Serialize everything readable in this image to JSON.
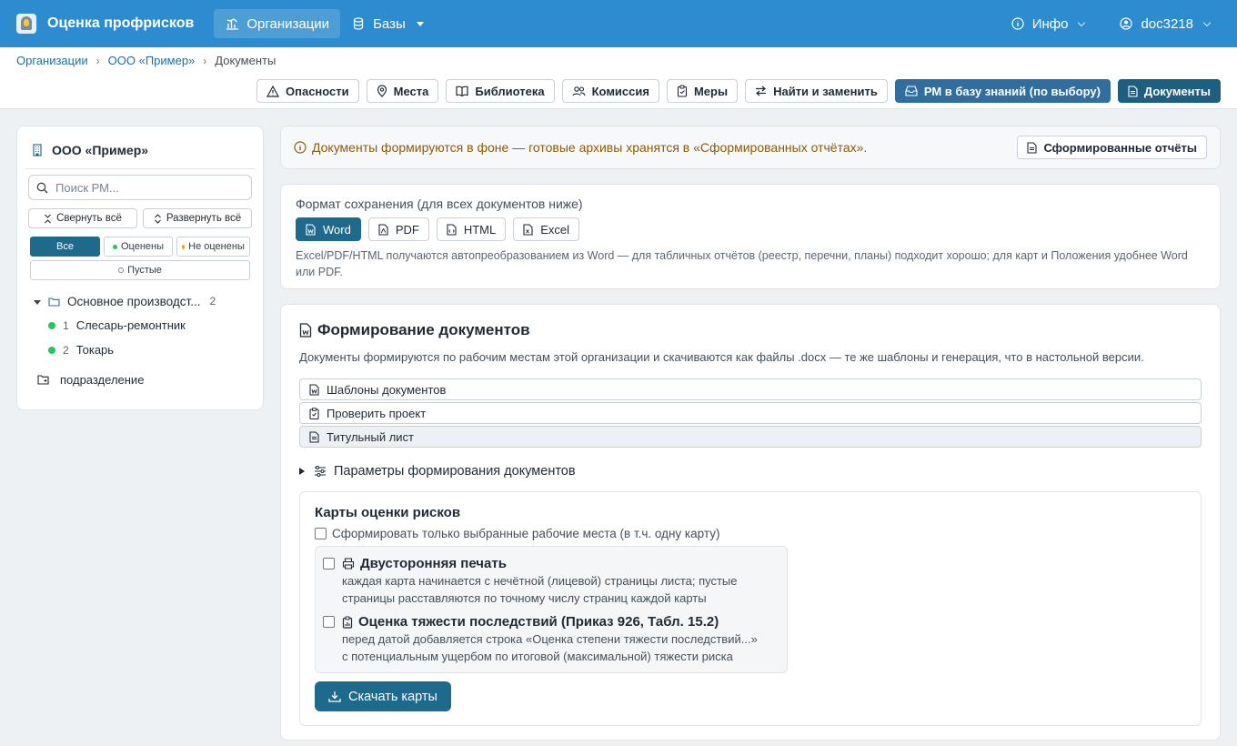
{
  "navbar": {
    "brand": "Оценка профрисков",
    "links": [
      {
        "label": "Организации",
        "icon": "bar-chart-icon",
        "active": true
      },
      {
        "label": "Базы",
        "icon": "database-icon",
        "active": false
      }
    ],
    "info": "Инфо",
    "user": "doc3218",
    "bg_color": "#2d8ccf"
  },
  "breadcrumb": {
    "items": [
      "Организации",
      "ООО «Пример»"
    ],
    "current": "Документы"
  },
  "toolbar": {
    "buttons": [
      "Опасности",
      "Места",
      "Библиотека",
      "Комиссия",
      "Меры",
      "Найти и заменить",
      "РМ в базу знаний (по выбору)",
      "Документы"
    ]
  },
  "sidebar": {
    "org_name": "ООО «Пример»",
    "search_placeholder": "Поиск РМ...",
    "collapse_label": "Свернуть всё",
    "expand_label": "Развернуть всё",
    "filters": [
      "Все",
      "Оценены",
      "Не оценены",
      "Пустые"
    ],
    "tree": {
      "group_label": "Основное производст...",
      "group_count": "2",
      "items": [
        {
          "num": "1",
          "label": "Слесарь-ремонтник"
        },
        {
          "num": "2",
          "label": "Токарь"
        }
      ],
      "dept_label": "подразделение"
    }
  },
  "notice": {
    "text": "Документы формируются в фоне — готовые архивы хранятся в «Сформированных отчётах».",
    "button": "Сформированные отчёты"
  },
  "format": {
    "label": "Формат сохранения (для всех документов ниже)",
    "options": [
      "Word",
      "PDF",
      "HTML",
      "Excel"
    ],
    "selected": "Word",
    "note": "Excel/PDF/HTML получаются автопреобразованием из Word — для табличных отчётов (реестр, перечни, планы) подходит хорошо; для карт и Положения удобнее Word или PDF."
  },
  "generation": {
    "title": "Формирование документов",
    "description": "Документы формируются по рабочим местам этой организации и скачиваются как файлы .docx — те же шаблоны и генерация, что в настольной версии.",
    "sections": [
      "Шаблоны документов",
      "Проверить проект",
      "Титульный лист"
    ],
    "params_label": "Параметры формирования документов",
    "maps": {
      "title": "Карты оценки рисков",
      "only_selected": "Сформировать только выбранные рабочие места (в т.ч. одну карту)",
      "options": [
        {
          "title": "Двусторонняя печать",
          "desc1": "каждая карта начинается с нечётной (лицевой) страницы листа; пустые",
          "desc2": "страницы расставляются по точному числу страниц каждой карты"
        },
        {
          "title": "Оценка тяжести последствий (Приказ 926, Табл. 15.2)",
          "desc1": "перед датой добавляется строка «Оценка степени тяжести последствий...»",
          "desc2": "с потенциальным ущербом по итоговой (максимальной) тяжести риска"
        }
      ],
      "download": "Скачать карты"
    }
  }
}
